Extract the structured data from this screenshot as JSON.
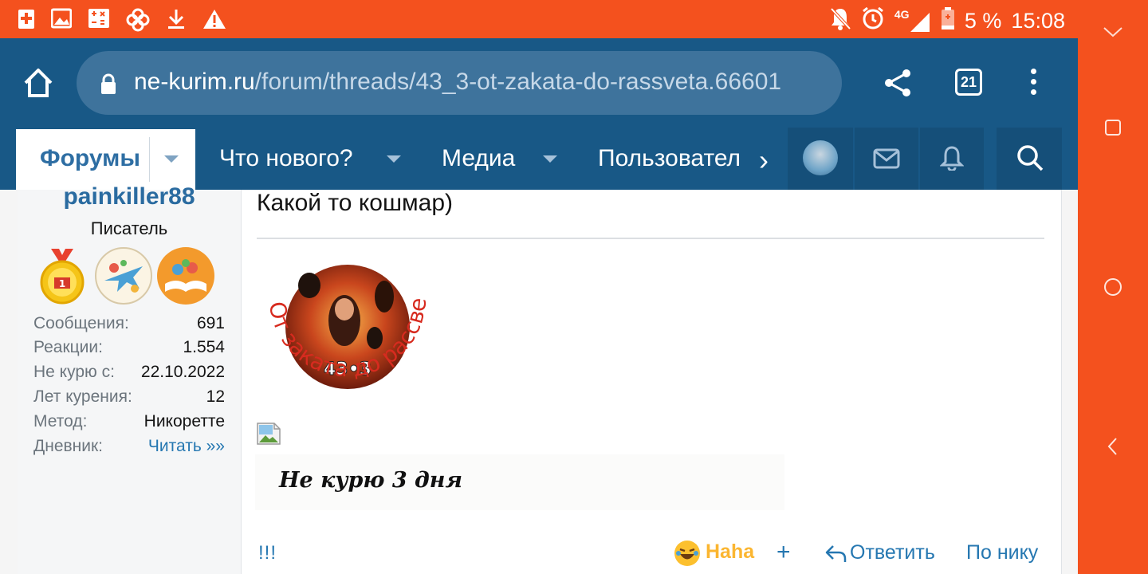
{
  "status_bar": {
    "battery": "5 %",
    "network": "4G",
    "time": "15:08",
    "left_icons": [
      "battery-saver-icon",
      "image-icon",
      "calculator-icon",
      "pinwheel-icon",
      "download-icon",
      "warning-icon"
    ],
    "right_icons": [
      "notifications-off-icon",
      "alarm-icon",
      "signal-icon",
      "battery-icon"
    ]
  },
  "browser": {
    "url_domain": "ne-kurim.ru",
    "url_path": "/forum/threads/43_3-ot-zakata-do-rassveta.66601",
    "tabs_count": "21"
  },
  "nav": {
    "items": [
      {
        "label": "Форумы"
      },
      {
        "label": "Что нового?"
      },
      {
        "label": "Медиа"
      },
      {
        "label": "Пользователи"
      }
    ]
  },
  "user": {
    "username": "painkiller88",
    "title": "Писатель",
    "badges": [
      "gold-medal-icon",
      "airplane-badge-icon",
      "book-badge-icon"
    ],
    "stats": [
      {
        "label": "Сообщения:",
        "value": "691"
      },
      {
        "label": "Реакции:",
        "value": "1.554"
      },
      {
        "label": "Не курю с:",
        "value": "22.10.2022"
      },
      {
        "label": "Лет курения:",
        "value": "12"
      },
      {
        "label": "Метод:",
        "value": "Никоретте"
      },
      {
        "label": "Дневник:",
        "value": "Читать »»"
      }
    ]
  },
  "post": {
    "text": "Какой то кошмар)",
    "badge_top_text": "43•3",
    "badge_arc_text": "От заката до рассвета",
    "signature": "Не курю  3 дня"
  },
  "actions": {
    "report": "!!!",
    "reaction": "Haha",
    "add": "+",
    "reply": "Ответить",
    "by_nick": "По нику"
  },
  "colors": {
    "status_bar": "#f4511e",
    "browser": "#185886",
    "link": "#2577b1",
    "reaction": "#fbb631"
  }
}
